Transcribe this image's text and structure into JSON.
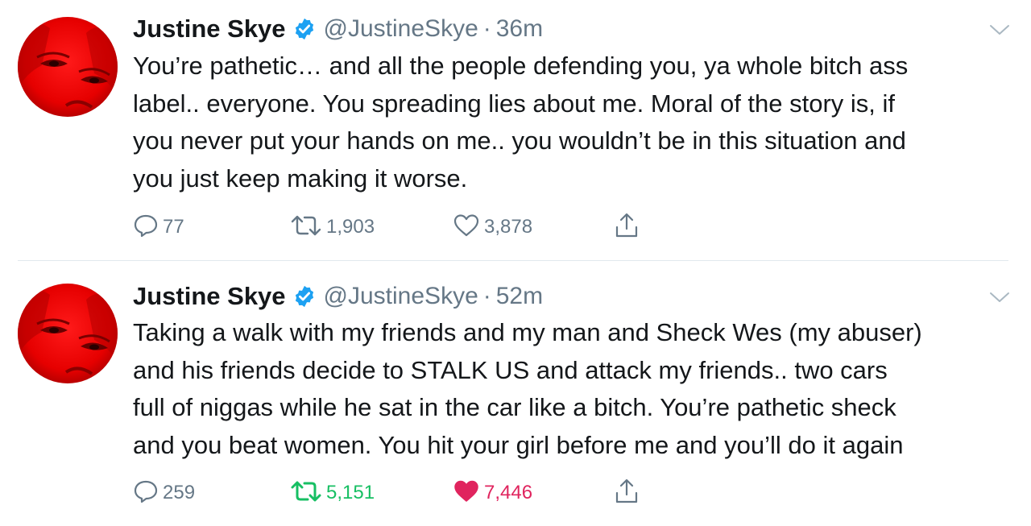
{
  "colors": {
    "text": "#14171a",
    "secondary": "#657786",
    "verified_badge": "#1da1f2",
    "retweet_active": "#17bf63",
    "like_active": "#e0245e",
    "divider": "#e1e8ed",
    "avatar_red": "#e60000"
  },
  "tweets": [
    {
      "author_name": "Justine Skye",
      "handle": "@JustineSkye",
      "separator": "·",
      "time": "36m",
      "text": "You’re pathetic… and all the people defending you, ya whole bitch ass\nlabel.. everyone. You spreading lies about me. Moral of the story is, if\nyou never put your hands on me.. you wouldn’t be in this situation and\nyou just keep making it worse.",
      "replies": "77",
      "retweets": "1,903",
      "likes": "3,878",
      "retweeted": false,
      "liked": false,
      "icons": [
        "avatar",
        "verified-badge-icon",
        "chevron-down-icon",
        "reply-icon",
        "retweet-icon",
        "heart-icon",
        "share-icon"
      ]
    },
    {
      "author_name": "Justine Skye",
      "handle": "@JustineSkye",
      "separator": "·",
      "time": "52m",
      "text": "Taking a walk with my friends and my man and Sheck Wes (my abuser)\nand his friends decide to STALK US and attack my friends.. two cars\nfull of niggas while he sat in the car like a bitch. You’re pathetic sheck\nand you beat women. You hit your girl before me and you’ll do it again",
      "replies": "259",
      "retweets": "5,151",
      "likes": "7,446",
      "retweeted": true,
      "liked": true,
      "icons": [
        "avatar",
        "verified-badge-icon",
        "chevron-down-icon",
        "reply-icon",
        "retweet-icon",
        "heart-filled-icon",
        "share-icon"
      ]
    }
  ]
}
